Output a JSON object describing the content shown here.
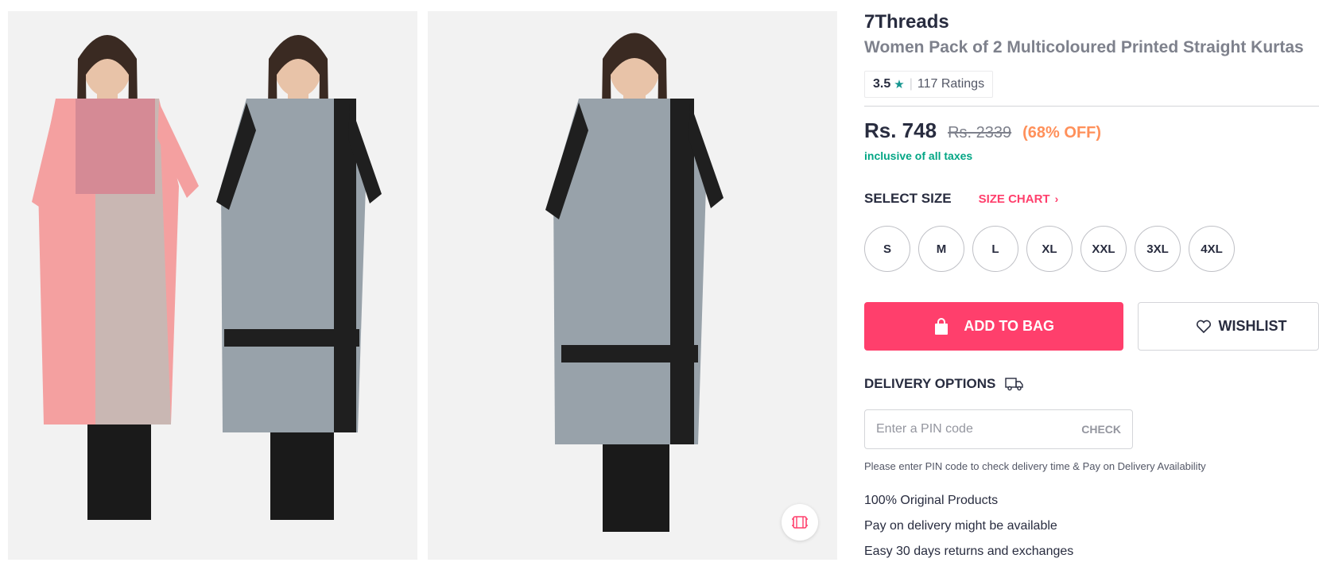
{
  "gallery": {
    "images": [
      {
        "alt": "7Threads kurta image 1",
        "icon": "product-photo"
      },
      {
        "alt": "7Threads kurta image 2",
        "icon": "product-photo"
      }
    ],
    "similar_icon": "similar-products-icon"
  },
  "product": {
    "brand": "7Threads",
    "name": "Women Pack of 2 Multicoloured Printed Straight Kurtas",
    "rating": "3.5",
    "rating_star": "★",
    "rating_separator": "|",
    "rating_count": "117 Ratings",
    "price": "Rs. 748",
    "mrp": "Rs. 2339",
    "discount": "(68% OFF)",
    "tax_note": "inclusive of all taxes"
  },
  "size": {
    "title": "SELECT SIZE",
    "chart_label": "SIZE CHART",
    "options": [
      "S",
      "M",
      "L",
      "XL",
      "XXL",
      "3XL",
      "4XL"
    ]
  },
  "actions": {
    "add_to_bag": "ADD TO BAG",
    "wishlist": "WISHLIST"
  },
  "delivery": {
    "title": "DELIVERY OPTIONS",
    "pin_placeholder": "Enter a PIN code",
    "check_label": "CHECK",
    "note": "Please enter PIN code to check delivery time & Pay on Delivery Availability",
    "features": [
      "100% Original Products",
      "Pay on delivery might be available",
      "Easy 30 days returns and exchanges"
    ]
  },
  "colors": {
    "accent": "#ff3f6c",
    "discount": "#ff905a",
    "tax_note": "#03a685",
    "rating_star": "#14958f"
  }
}
